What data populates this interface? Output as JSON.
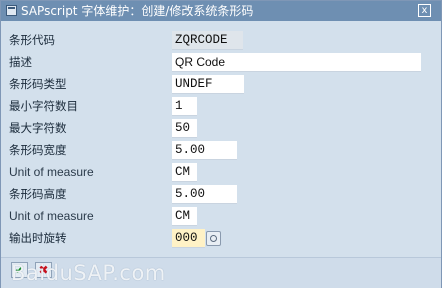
{
  "window": {
    "title": "SAPscript 字体维护：创建/修改系统条形码",
    "close_symbol": "x",
    "title_icon": "sap-window-icon"
  },
  "form": {
    "fields": [
      {
        "label": "条形代码",
        "value": "ZQRCODE",
        "state": "readonly"
      },
      {
        "label": "描述",
        "value": "QR Code",
        "state": "editable"
      },
      {
        "label": "条形码类型",
        "value": "UNDEF",
        "state": "editable"
      },
      {
        "label": "最小字符数目",
        "value": "1",
        "state": "editable"
      },
      {
        "label": "最大字符数",
        "value": "50",
        "state": "editable"
      },
      {
        "label": "条形码宽度",
        "value": "5.00",
        "state": "editable"
      },
      {
        "label": "Unit of measure",
        "value": "CM",
        "state": "editable"
      },
      {
        "label": "条形码高度",
        "value": "5.00",
        "state": "editable"
      },
      {
        "label": "Unit of measure",
        "value": "CM",
        "state": "editable"
      },
      {
        "label": "输出时旋转",
        "value": "000",
        "state": "required",
        "has_value_help": true
      }
    ]
  },
  "footer": {
    "ok_symbol": "✔",
    "cancel_symbol": "✖",
    "watermark": "BaiduSAP.com"
  },
  "colors": {
    "titlebar": "#6e8fb2",
    "background": "#d3e0ec",
    "required_field": "#fff2c6"
  }
}
